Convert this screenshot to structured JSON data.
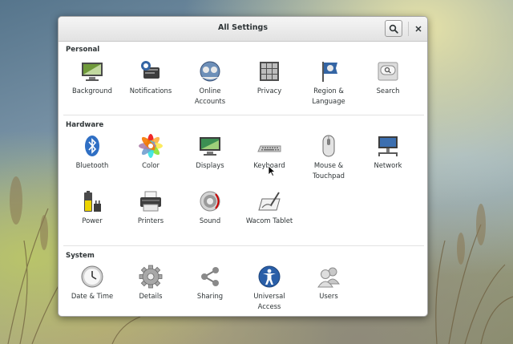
{
  "window": {
    "title": "All Settings"
  },
  "titlebar": {
    "search_icon": "search-icon",
    "close_glyph": "×"
  },
  "sections": [
    {
      "title": "Personal",
      "items": [
        {
          "label": "Background",
          "icon": "background-icon"
        },
        {
          "label": "Notifications",
          "icon": "notifications-icon"
        },
        {
          "label": "Online\nAccounts",
          "icon": "online-accounts-icon"
        },
        {
          "label": "Privacy",
          "icon": "privacy-icon"
        },
        {
          "label": "Region &\nLanguage",
          "icon": "region-language-icon"
        },
        {
          "label": "Search",
          "icon": "search-settings-icon"
        }
      ]
    },
    {
      "title": "Hardware",
      "items": [
        {
          "label": "Bluetooth",
          "icon": "bluetooth-icon"
        },
        {
          "label": "Color",
          "icon": "color-icon"
        },
        {
          "label": "Displays",
          "icon": "displays-icon"
        },
        {
          "label": "Keyboard",
          "icon": "keyboard-icon"
        },
        {
          "label": "Mouse &\nTouchpad",
          "icon": "mouse-icon"
        },
        {
          "label": "Network",
          "icon": "network-icon"
        },
        {
          "label": "Power",
          "icon": "power-icon"
        },
        {
          "label": "Printers",
          "icon": "printers-icon"
        },
        {
          "label": "Sound",
          "icon": "sound-icon"
        },
        {
          "label": "Wacom Tablet",
          "icon": "wacom-tablet-icon"
        }
      ]
    },
    {
      "title": "System",
      "items": [
        {
          "label": "Date & Time",
          "icon": "clock-icon"
        },
        {
          "label": "Details",
          "icon": "details-gear-icon"
        },
        {
          "label": "Sharing",
          "icon": "sharing-icon"
        },
        {
          "label": "Universal\nAccess",
          "icon": "universal-access-icon"
        },
        {
          "label": "Users",
          "icon": "users-icon"
        }
      ]
    }
  ]
}
